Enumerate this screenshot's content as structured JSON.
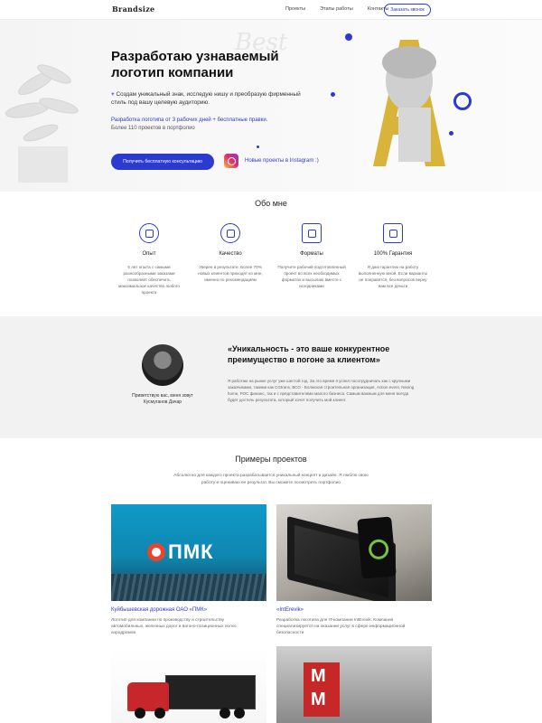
{
  "header": {
    "logo": "Brandsize",
    "nav": [
      "Проекты",
      "Этапы работы",
      "Контакты"
    ],
    "order_button": "Заказать звонок"
  },
  "hero": {
    "title": "Разработаю узнаваемый логотип компании",
    "subtitle_plus": "+",
    "subtitle": "Создам уникальный знак, исследую нишу и преобразую фирменный стиль под вашу целевую аудиторию.",
    "note_blue": "Разработка логотипа от 3 рабочих дней + бесплатные правки.",
    "note_gray": "Более 110 проектов в портфолио",
    "cta_button": "Получить бесплатную консультацию",
    "instagram_link": "Новые проекты в Instagram :)",
    "big_letter": "A"
  },
  "about": {
    "title": "Обо мне",
    "items": [
      {
        "icon": "badge-icon",
        "name": "Опыт",
        "desc": "5 лет опыта с самыми разнообразными заказами позволяет обеспечить максимальное качество любого проекта"
      },
      {
        "icon": "diamond-icon",
        "name": "Качество",
        "desc": "Уверен в результате. Более 70% новых клиентов приходят ко мне, именно по рекомендациям"
      },
      {
        "icon": "files-icon",
        "name": "Форматы",
        "desc": "Получите рабочий подготовленный проект во всех необходимых форматах и высылаю вместе с исходниками"
      },
      {
        "icon": "checkmark-icon",
        "name": "100% Гарантия",
        "desc": "Я даю гарантию на работу выполненную мной. Если варианты не понравятся, без вопросов верну вам все деньги"
      }
    ]
  },
  "quote": {
    "greeting": "Приветствую вас, меня зовут",
    "name": "Кусмуганов Дачар",
    "title": "«Уникальность - это ваше конкурентное преимущество в погоне за клиентом»",
    "text": "Я работаю на рынке услуг уже шестой год. За это время я успел посотрудничать как с крупными заказчиками, такими как CGtrans, ВСО - Волжская строительная организация, Action event, Nexing home, РОС финанс, так и с представителями малого бизнеса. Самым важным для меня всегда будет достичь результата, который хочет получить мой клиент."
  },
  "projects": {
    "title": "Примеры проектов",
    "intro": "Абсолютно для каждого проекта разрабатывается уникальный концепт и дизайн. Я люблю свою работу и оцениваю ее результат. Вы сможете посмотреть портфолио",
    "cards": [
      {
        "title": "Куйбышевская дорожная ОАО «ПМК»",
        "desc": "Логотип для компании по производству и строительству автомобильных, железных дорог и вагоно-позиционных полос аэродромов",
        "logo_text": "ПМК"
      },
      {
        "title": "«IntErevik»",
        "desc": "Разработка логотипа для IT-компании IntErevik. Компания специализируется на оказании услуг в сфере информационной безопасности"
      },
      {
        "title": "",
        "desc": ""
      },
      {
        "title": "",
        "desc": ""
      }
    ]
  },
  "colors": {
    "accent": "#2b3bd1",
    "gold": "#d9b43a",
    "quote_bg": "#f2f2f2"
  }
}
